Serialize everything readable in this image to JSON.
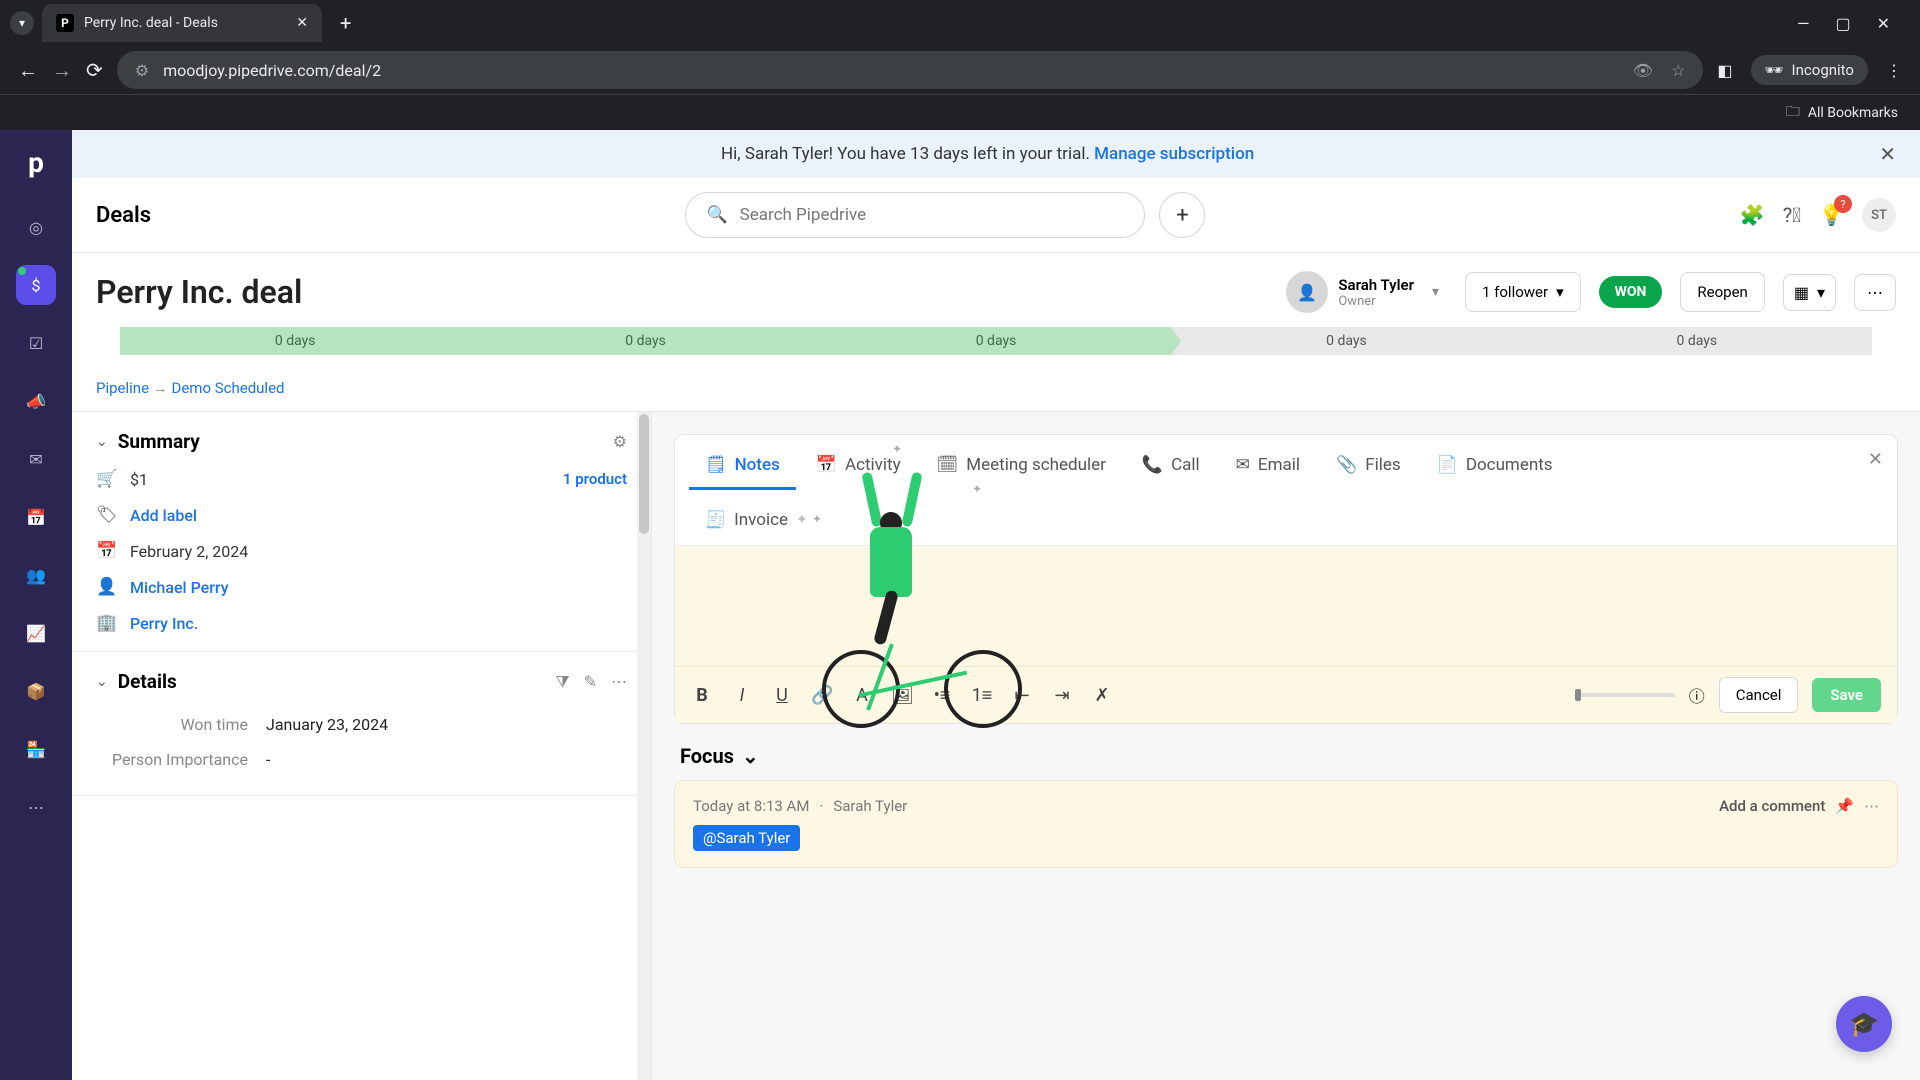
{
  "browser": {
    "tab_title": "Perry Inc. deal - Deals",
    "url": "moodjoy.pipedrive.com/deal/2",
    "incognito_label": "Incognito",
    "all_bookmarks": "All Bookmarks"
  },
  "trial_banner": {
    "greeting": "Hi, Sarah Tyler! You have 13 days left in your trial. ",
    "link": "Manage subscription"
  },
  "topbar": {
    "section": "Deals",
    "search_placeholder": "Search Pipedrive",
    "bulb_badge": "?",
    "avatar_initials": "ST"
  },
  "deal": {
    "title": "Perry Inc. deal",
    "owner_name": "Sarah Tyler",
    "owner_role": "Owner",
    "followers": "1 follower",
    "status": "WON",
    "reopen": "Reopen"
  },
  "stages": [
    "0 days",
    "0 days",
    "0 days",
    "0 days",
    "0 days"
  ],
  "stage_done_count": 3,
  "breadcrumb": {
    "pipeline": "Pipeline",
    "arrow": "→",
    "stage": "Demo Scheduled"
  },
  "summary": {
    "title": "Summary",
    "amount": "$1",
    "product_link": "1 product",
    "add_label": "Add label",
    "date": "February 2, 2024",
    "person": "Michael Perry",
    "org": "Perry Inc."
  },
  "details": {
    "title": "Details",
    "rows": [
      {
        "label": "Won time",
        "value": "January 23, 2024"
      },
      {
        "label": "Person Importance",
        "value": "-"
      }
    ]
  },
  "composer": {
    "tabs": {
      "notes": "Notes",
      "activity": "Activity",
      "meeting": "Meeting scheduler",
      "call": "Call",
      "email": "Email",
      "files": "Files",
      "documents": "Documents",
      "invoice": "Invoice"
    },
    "cancel": "Cancel",
    "save": "Save"
  },
  "focus": {
    "title": "Focus",
    "timestamp": "Today at 8:13 AM",
    "author": "Sarah Tyler",
    "add_comment": "Add a comment",
    "mention": "@Sarah Tyler"
  }
}
